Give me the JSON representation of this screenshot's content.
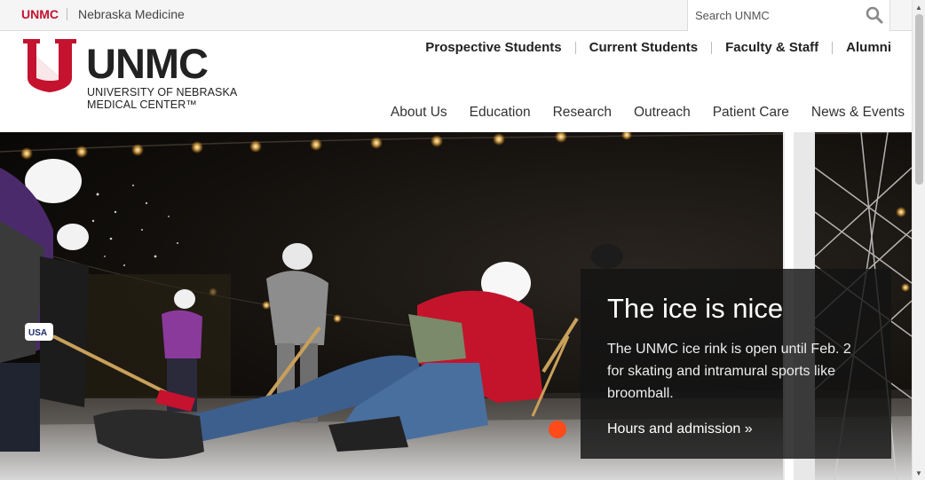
{
  "utility": {
    "unmc_label": "UNMC",
    "nebraska_medicine_label": "Nebraska Medicine",
    "search_placeholder": "Search UNMC"
  },
  "logo": {
    "wordmark": "UNMC",
    "line1": "UNIVERSITY OF NEBRASKA",
    "line2": "MEDICAL CENTER™"
  },
  "audience_nav": [
    "Prospective Students",
    "Current Students",
    "Faculty & Staff",
    "Alumni"
  ],
  "main_nav": [
    "About Us",
    "Education",
    "Research",
    "Outreach",
    "Patient Care",
    "News & Events"
  ],
  "hero": {
    "title": "The ice is nice",
    "body": "The UNMC ice rink is open until Feb. 2 for skating and intramural sports like broomball.",
    "link": "Hours and admission »",
    "helmet_text": "USA"
  },
  "colors": {
    "brand_red": "#c4122f",
    "caption_bg": "#141414"
  }
}
